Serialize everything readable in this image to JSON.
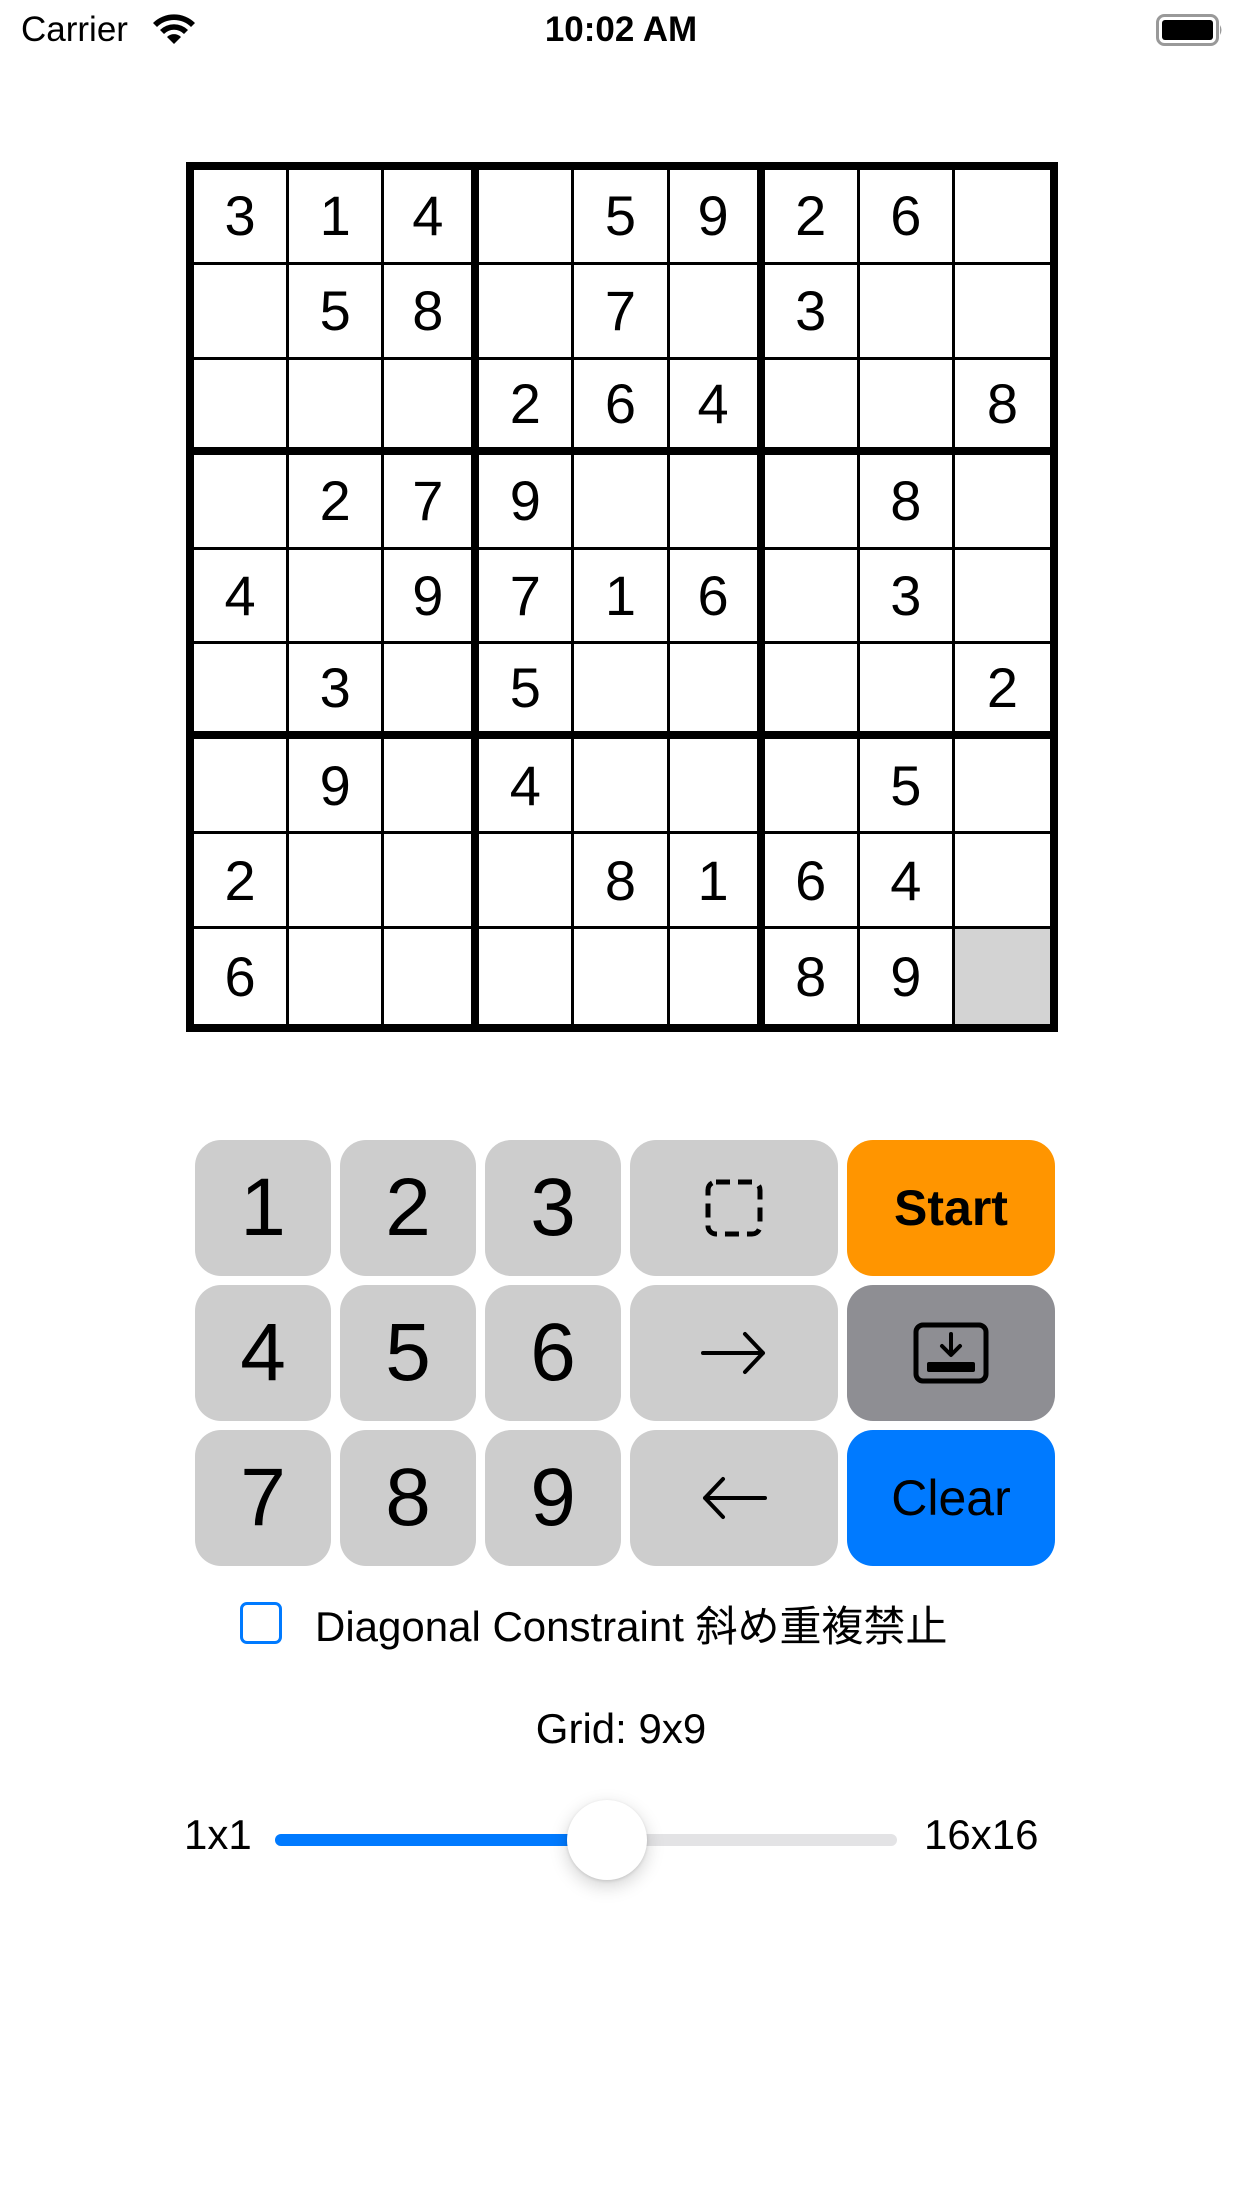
{
  "status_bar": {
    "carrier": "Carrier",
    "time": "10:02 AM",
    "wifi_icon": "wifi-icon",
    "battery_icon": "battery-icon"
  },
  "board": {
    "size": 9,
    "box_size": 3,
    "cells": [
      [
        "3",
        "1",
        "4",
        "",
        "5",
        "9",
        "2",
        "6",
        ""
      ],
      [
        "",
        "5",
        "8",
        "",
        "7",
        "",
        "3",
        "",
        ""
      ],
      [
        "",
        "",
        "",
        "2",
        "6",
        "4",
        "",
        "",
        "8"
      ],
      [
        "",
        "2",
        "7",
        "9",
        "",
        "",
        "",
        "8",
        ""
      ],
      [
        "4",
        "",
        "9",
        "7",
        "1",
        "6",
        "",
        "3",
        ""
      ],
      [
        "",
        "3",
        "",
        "5",
        "",
        "",
        "",
        "",
        "2"
      ],
      [
        "",
        "9",
        "",
        "4",
        "",
        "",
        "",
        "5",
        ""
      ],
      [
        "2",
        "",
        "",
        "",
        "8",
        "1",
        "6",
        "4",
        ""
      ],
      [
        "6",
        "",
        "",
        "",
        "",
        "",
        "8",
        "9",
        ""
      ]
    ],
    "selected_cell": {
      "row": 9,
      "col": 9
    },
    "selected_color": "#d3d3d3"
  },
  "keypad": {
    "digits": [
      "1",
      "2",
      "3",
      "4",
      "5",
      "6",
      "7",
      "8",
      "9"
    ],
    "select_icon": "dashed-selection-icon",
    "next_icon": "arrow-right-icon",
    "prev_icon": "arrow-left-icon",
    "start_label": "Start",
    "save_icon": "save-download-icon",
    "clear_label": "Clear",
    "colors": {
      "key": "#cdcdcd",
      "start": "#ff9500",
      "save": "#8e8e93",
      "clear": "#007aff"
    }
  },
  "options": {
    "diagonal_label": "Diagonal Constraint 斜め重複禁止",
    "diagonal_checked": false
  },
  "grid_size": {
    "label": "Grid: 9x9",
    "min_label": "1x1",
    "max_label": "16x16",
    "min": 1,
    "max": 16,
    "value": 9,
    "accent": "#007aff"
  }
}
